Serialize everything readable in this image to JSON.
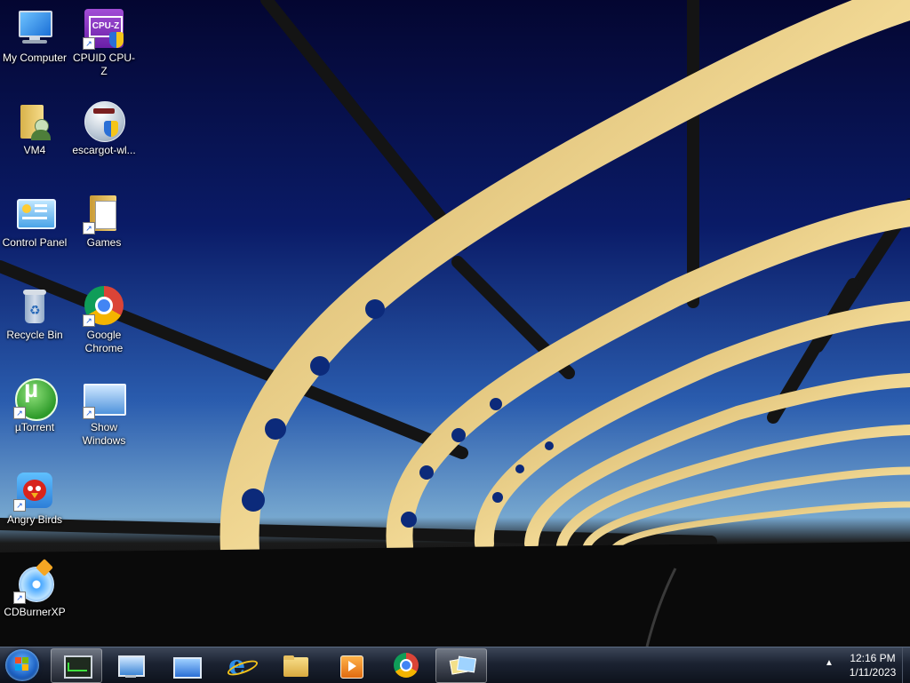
{
  "desktop": {
    "icons": [
      {
        "id": "my-computer",
        "label": "My Computer",
        "shortcut": false
      },
      {
        "id": "cpuz",
        "label": "CPUID CPU-Z",
        "shortcut": true
      },
      {
        "id": "vm4",
        "label": "VM4",
        "shortcut": false
      },
      {
        "id": "escargot",
        "label": "escargot-wl...",
        "shortcut": false
      },
      {
        "id": "control-panel",
        "label": "Control Panel",
        "shortcut": false
      },
      {
        "id": "games",
        "label": "Games",
        "shortcut": true
      },
      {
        "id": "recycle-bin",
        "label": "Recycle Bin",
        "shortcut": false
      },
      {
        "id": "chrome",
        "label": "Google Chrome",
        "shortcut": true
      },
      {
        "id": "utorrent",
        "label": "µTorrent",
        "shortcut": true
      },
      {
        "id": "show-windows",
        "label": "Show Windows",
        "shortcut": true
      },
      {
        "id": "angry-birds",
        "label": "Angry Birds",
        "shortcut": true
      },
      {
        "id": "cdburnerxp",
        "label": "CDBurnerXP",
        "shortcut": true
      }
    ],
    "cpuz_badge": "CPU-Z",
    "shortcut_glyph": "↗"
  },
  "taskbar": {
    "start_icon": "windows-orb-icon",
    "buttons": [
      {
        "name": "task-manager",
        "icon": "task-manager-icon",
        "active": true
      },
      {
        "name": "system-monitor",
        "icon": "monitor-check-icon",
        "active": false
      },
      {
        "name": "show-desktop-app",
        "icon": "blue-window-icon",
        "active": false
      },
      {
        "name": "internet-explorer",
        "icon": "ie-icon",
        "active": false
      },
      {
        "name": "file-explorer",
        "icon": "folder-icon",
        "active": false
      },
      {
        "name": "media-player",
        "icon": "media-player-icon",
        "active": false
      },
      {
        "name": "chrome",
        "icon": "chrome-icon",
        "active": false
      },
      {
        "name": "switch-windows",
        "icon": "switch-windows-icon",
        "active": true
      }
    ],
    "tray": {
      "arrow": "▲",
      "time": "12:16 PM",
      "date": "1/11/2023"
    }
  },
  "colors": {
    "sky_top": "#05083a",
    "sky_horizon": "#6fa3cc",
    "bridge_gold": "#e6c774",
    "taskbar": "#1b2231"
  }
}
